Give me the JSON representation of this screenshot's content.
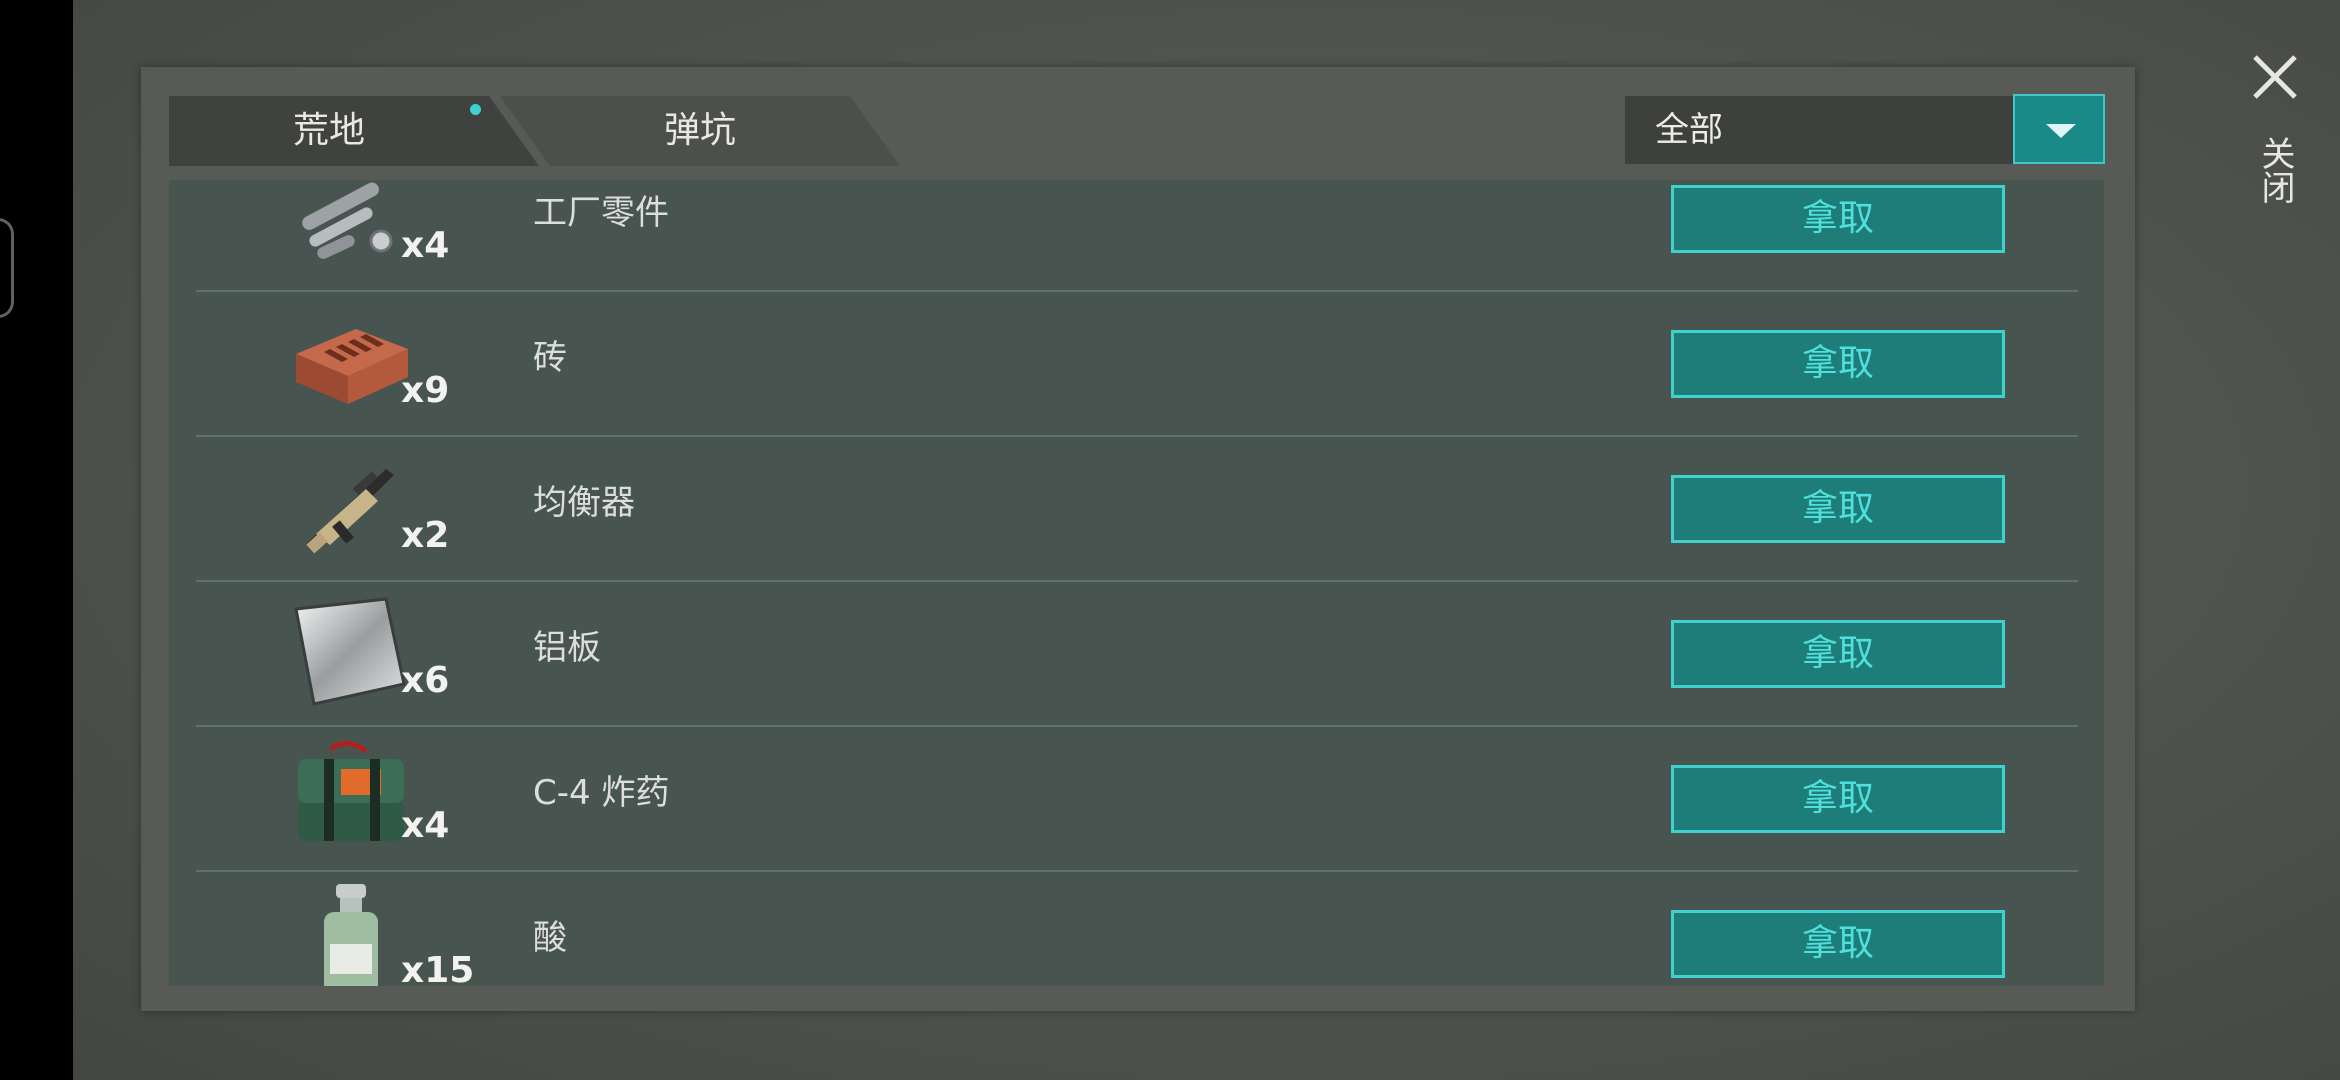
{
  "tabs": [
    {
      "label": "荒地",
      "active": true,
      "has_notification": true
    },
    {
      "label": "弹坑",
      "active": false
    }
  ],
  "filter": {
    "selected": "全部"
  },
  "close": {
    "label": "关闭"
  },
  "items": [
    {
      "name": "工厂零件",
      "qty": "x4",
      "icon": "factory-parts-icon",
      "action": "拿取"
    },
    {
      "name": "砖",
      "qty": "x9",
      "icon": "brick-icon",
      "action": "拿取"
    },
    {
      "name": "均衡器",
      "qty": "x2",
      "icon": "rifle-icon",
      "action": "拿取"
    },
    {
      "name": "铝板",
      "qty": "x6",
      "icon": "aluminum-sheet-icon",
      "action": "拿取"
    },
    {
      "name": "C-4 炸药",
      "qty": "x4",
      "icon": "c4-explosive-icon",
      "action": "拿取"
    },
    {
      "name": "酸",
      "qty": "x15",
      "icon": "acid-bottle-icon",
      "action": "拿取"
    }
  ],
  "colors": {
    "accent": "#1e7c79",
    "accent_border": "#3fd1cd",
    "accent_text": "#4fe0dc"
  }
}
